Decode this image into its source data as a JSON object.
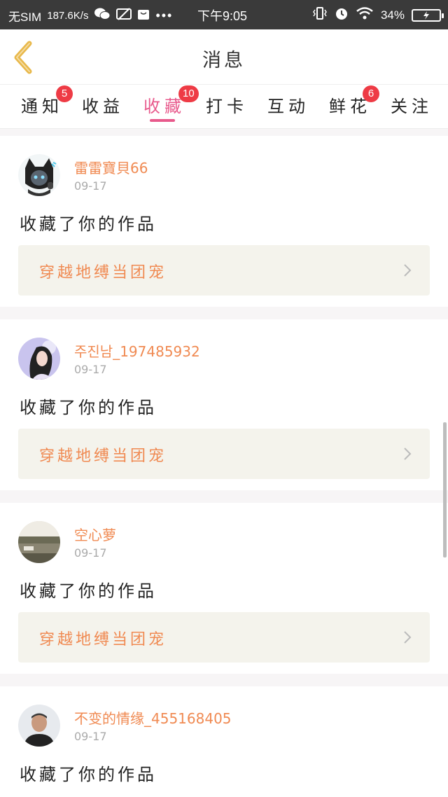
{
  "status_bar": {
    "carrier": "无SIM",
    "net_speed": "187.6K/s",
    "time": "下午9:05",
    "battery": "34%"
  },
  "header": {
    "title": "消息"
  },
  "tabs": [
    {
      "label": "通知",
      "badge": "5"
    },
    {
      "label": "收益",
      "badge": ""
    },
    {
      "label": "收藏",
      "badge": "10",
      "active": true
    },
    {
      "label": "打卡",
      "badge": ""
    },
    {
      "label": "互动",
      "badge": ""
    },
    {
      "label": "鲜花",
      "badge": "6"
    },
    {
      "label": "关注",
      "badge": ""
    }
  ],
  "messages": [
    {
      "username": "雷雷寶貝66",
      "date": "09-17",
      "action": "收藏了你的作品",
      "work_title": "穿越地缚当团宠"
    },
    {
      "username": "주진남_197485932",
      "date": "09-17",
      "action": "收藏了你的作品",
      "work_title": "穿越地缚当团宠"
    },
    {
      "username": "空心萝",
      "date": "09-17",
      "action": "收藏了你的作品",
      "work_title": "穿越地缚当团宠"
    },
    {
      "username": "不变的情缘_455168405",
      "date": "09-17",
      "action": "收藏了你的作品",
      "work_title": ""
    }
  ],
  "colors": {
    "accent": "#e85a8c",
    "username": "#f08a52",
    "badge": "#ee3b45",
    "back_arrow": "#e8b84a"
  }
}
